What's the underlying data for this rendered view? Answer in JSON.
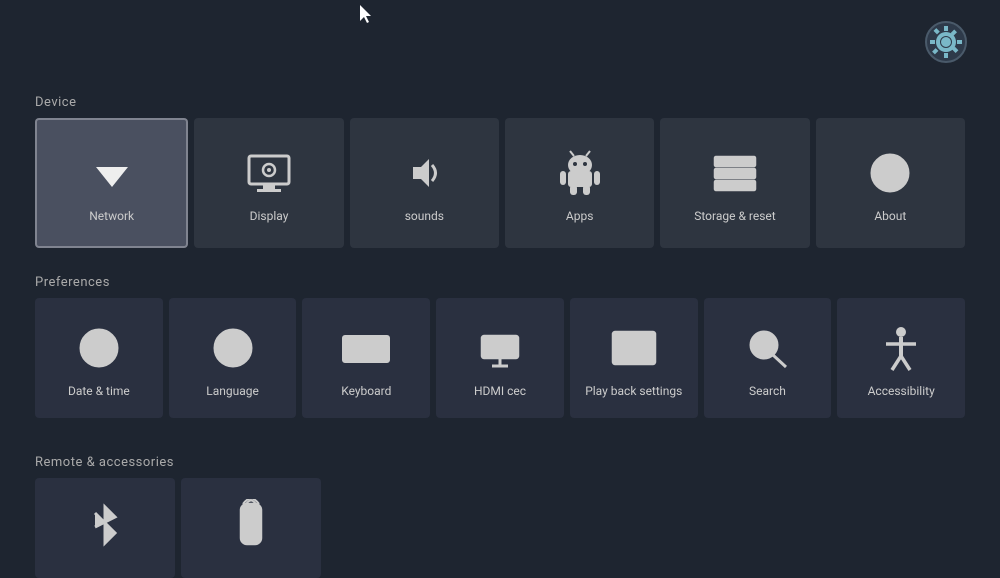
{
  "sections": {
    "device": {
      "label": "Device",
      "tiles": [
        {
          "id": "network",
          "label": "Network",
          "icon": "wifi",
          "selected": true
        },
        {
          "id": "display",
          "label": "Display",
          "icon": "display",
          "selected": false
        },
        {
          "id": "sounds",
          "label": "sounds",
          "icon": "volume",
          "selected": false
        },
        {
          "id": "apps",
          "label": "Apps",
          "icon": "android",
          "selected": false
        },
        {
          "id": "storage",
          "label": "Storage & reset",
          "icon": "storage",
          "selected": false
        },
        {
          "id": "about",
          "label": "About",
          "icon": "info",
          "selected": false
        }
      ]
    },
    "preferences": {
      "label": "Preferences",
      "tiles": [
        {
          "id": "datetime",
          "label": "Date & time",
          "icon": "clock"
        },
        {
          "id": "language",
          "label": "Language",
          "icon": "globe"
        },
        {
          "id": "keyboard",
          "label": "Keyboard",
          "icon": "keyboard"
        },
        {
          "id": "hdmi",
          "label": "HDMI cec",
          "icon": "hdmi"
        },
        {
          "id": "playback",
          "label": "Play back settings",
          "icon": "film"
        },
        {
          "id": "search",
          "label": "Search",
          "icon": "search"
        },
        {
          "id": "accessibility",
          "label": "Accessibility",
          "icon": "accessibility"
        }
      ]
    },
    "remote": {
      "label": "Remote & accessories",
      "tiles": [
        {
          "id": "bluetooth",
          "label": "",
          "icon": "bluetooth"
        },
        {
          "id": "remote",
          "label": "",
          "icon": "remote"
        }
      ]
    }
  }
}
